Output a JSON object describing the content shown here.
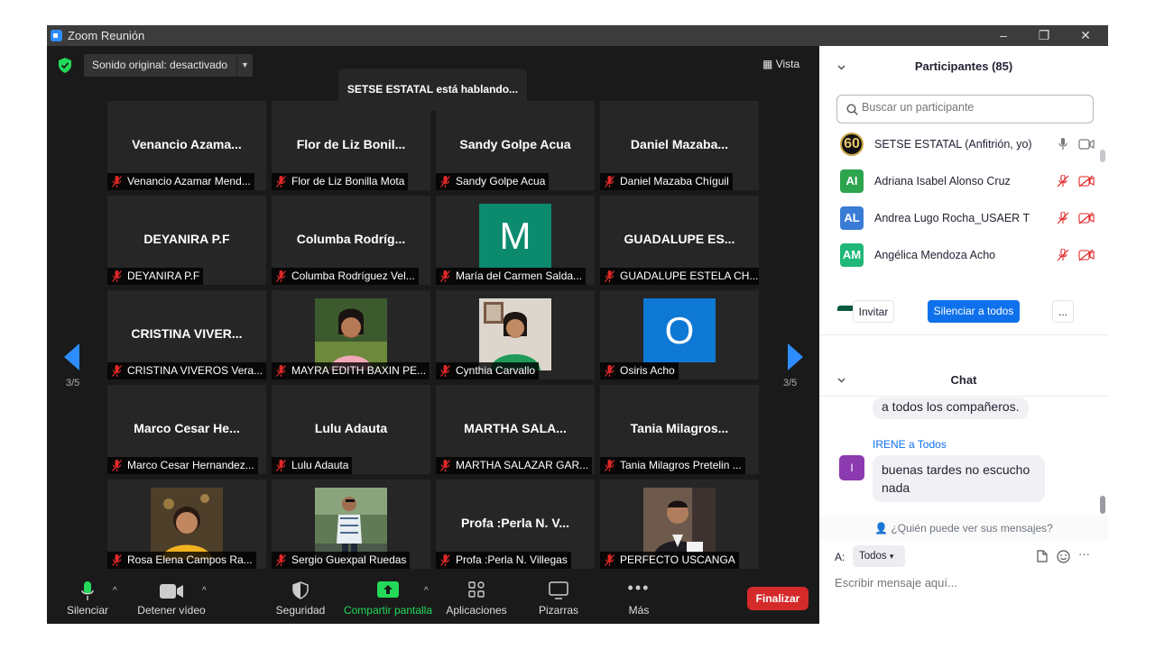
{
  "window": {
    "title": "Zoom Reunión",
    "controls": [
      "–",
      "❐",
      "✕"
    ]
  },
  "meeting": {
    "sound_label": "Sonido original: desactivado",
    "speaking_banner": "SETSE ESTATAL está hablando...",
    "view_label": "Vista",
    "page_indicator": "3/5",
    "tiles": [
      {
        "big": "Venancio  Azama...",
        "caption": "Venancio Azamar Mend..."
      },
      {
        "big": "Flor de Liz Bonil...",
        "caption": "Flor de Liz Bonilla Mota"
      },
      {
        "big": "Sandy Golpe Acua",
        "caption": "Sandy Golpe Acua"
      },
      {
        "big": "Daniel  Mazaba...",
        "caption": "Daniel Mazaba Chíguil"
      },
      {
        "big": "DEYANIRA P.F",
        "caption": "DEYANIRA P.F"
      },
      {
        "big": "Columba  Rodríg...",
        "caption": "Columba Rodríguez Vel..."
      },
      {
        "avatar": "M",
        "avatar_color": "#0b8a6e",
        "caption": "María del Carmen Salda..."
      },
      {
        "big": "GUADALUPE ES...",
        "caption": "GUADALUPE ESTELA CH..."
      },
      {
        "big": "CRISTINA  VIVER...",
        "caption": "CRISTINA VIVEROS Vera..."
      },
      {
        "photo": "pink",
        "caption": "MAYRA EDITH BAXIN PE..."
      },
      {
        "photo": "green",
        "caption": "Cynthia Carvallo"
      },
      {
        "avatar": "O",
        "avatar_color": "#0e78d5",
        "caption": "Osiris Acho"
      },
      {
        "big": "Marco Cesar He...",
        "caption": "Marco Cesar Hernandez..."
      },
      {
        "big": "Lulu Adauta",
        "caption": "Lulu Adauta"
      },
      {
        "big": "MARTHA  SALA...",
        "caption": "MARTHA SALAZAR GAR..."
      },
      {
        "big": "Tania  Milagros...",
        "caption": "Tania Milagros Pretelin ..."
      },
      {
        "photo": "yellow",
        "caption": "Rosa Elena Campos Ra..."
      },
      {
        "photo": "outdoor",
        "caption": "Sergio Guexpal Ruedas"
      },
      {
        "big": "Profa :Perla N. V...",
        "caption": "Profa :Perla N. Villegas"
      },
      {
        "photo": "suit",
        "caption": "PERFECTO USCANGA"
      }
    ]
  },
  "toolbar": {
    "mute": "Silenciar",
    "video": "Detener vídeo",
    "security": "Seguridad",
    "share": "Compartir pantalla",
    "apps": "Aplicaciones",
    "whiteboards": "Pizarras",
    "more": "Más",
    "end": "Finalizar"
  },
  "participants": {
    "header": "Participantes (85)",
    "search_placeholder": "Buscar un participante",
    "list": [
      {
        "initials": "60",
        "name": "SETSE ESTATAL (Anfitrión, yo)",
        "color": "#111111",
        "muted": false
      },
      {
        "initials": "AI",
        "name": "Adriana Isabel Alonso Cruz",
        "color": "#2da44e",
        "muted": true
      },
      {
        "initials": "AL",
        "name": "Andrea Lugo Rocha_USAER T",
        "color": "#3a7bd5",
        "muted": true
      },
      {
        "initials": "AM",
        "name": "Angélica Mendoza Acho",
        "color": "#1fb878",
        "muted": true
      }
    ],
    "invite": "Invitar",
    "mute_all": "Silenciar a todos",
    "more": "..."
  },
  "chat": {
    "header": "Chat",
    "prev_message_tail": "a todos los compañeros.",
    "sender": "IRENE a Todos",
    "sender_initial": "I",
    "message": "buenas tardes no escucho nada",
    "who_can_see": "¿Quién puede ver sus mensajes?",
    "to_label": "A:",
    "to_value": "Todos",
    "input_placeholder": "Escribir mensaje aquí..."
  },
  "colors": {
    "accent": "#2d8cff",
    "end_red": "#d42a2a",
    "share_green": "#23d959",
    "panel_blue": "#0e71eb"
  }
}
